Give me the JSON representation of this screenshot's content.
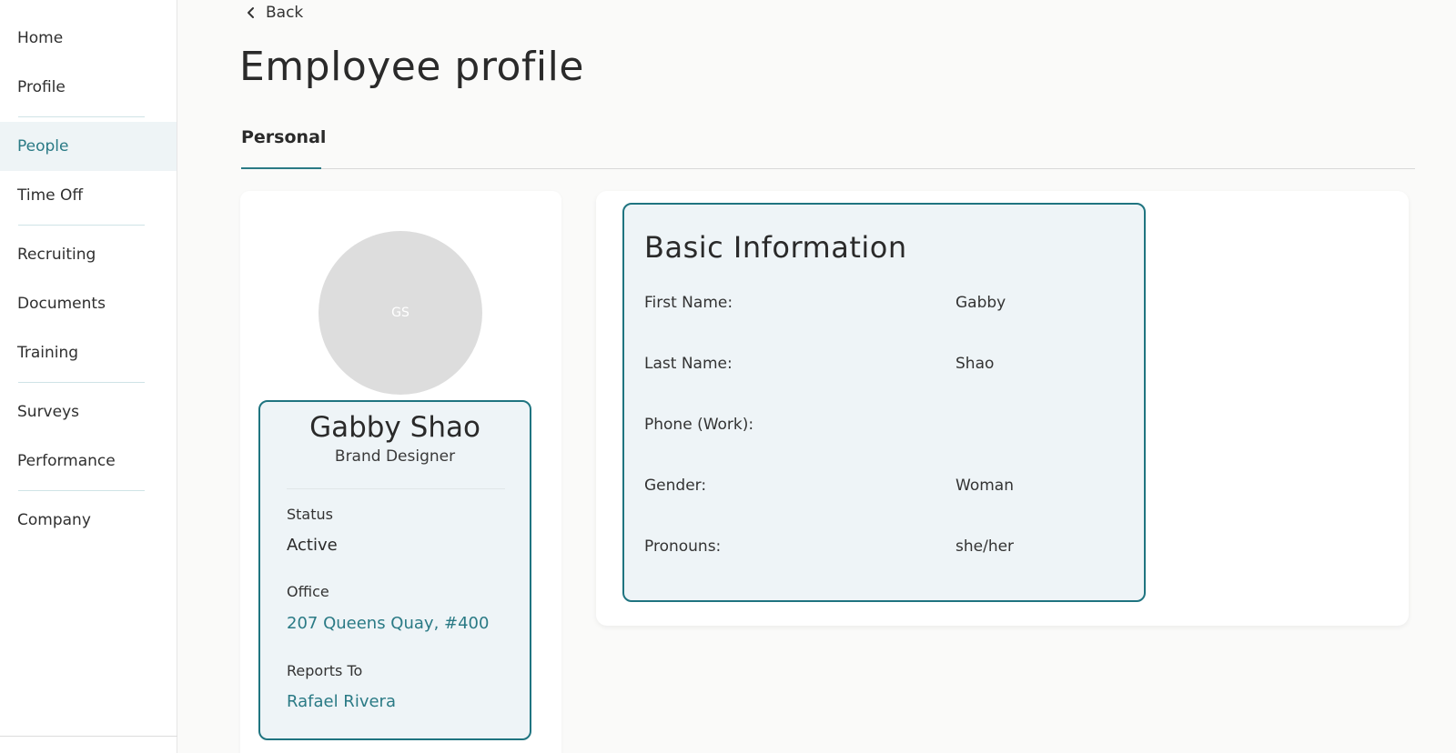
{
  "sidebar": {
    "items": [
      {
        "label": "Home"
      },
      {
        "label": "Profile"
      },
      {
        "label": "People"
      },
      {
        "label": "Time Off"
      },
      {
        "label": "Recruiting"
      },
      {
        "label": "Documents"
      },
      {
        "label": "Training"
      },
      {
        "label": "Surveys"
      },
      {
        "label": "Performance"
      },
      {
        "label": "Company"
      }
    ],
    "active": "People"
  },
  "header": {
    "back_label": "Back",
    "title": "Employee profile"
  },
  "tabs": [
    {
      "label": "Personal",
      "active": true
    }
  ],
  "profile": {
    "avatar_initials": "GS",
    "name": "Gabby Shao",
    "role": "Brand Designer",
    "status_label": "Status",
    "status_value": "Active",
    "office_label": "Office",
    "office_value": "207 Queens Quay, #400",
    "reports_to_label": "Reports To",
    "reports_to_value": "Rafael Rivera"
  },
  "basic_info": {
    "title": "Basic Information",
    "fields": [
      {
        "label": "First Name:",
        "value": "Gabby"
      },
      {
        "label": "Last Name:",
        "value": "Shao"
      },
      {
        "label": "Phone (Work):",
        "value": ""
      },
      {
        "label": "Gender:",
        "value": "Woman"
      },
      {
        "label": "Pronouns:",
        "value": "she/her"
      }
    ]
  },
  "colors": {
    "accent": "#2a7a85",
    "highlight_border": "#1f7480",
    "highlight_fill": "#eef4f7",
    "active_nav_bg": "#eef4f6"
  },
  "icons": {
    "back": "chevron-left-icon"
  }
}
